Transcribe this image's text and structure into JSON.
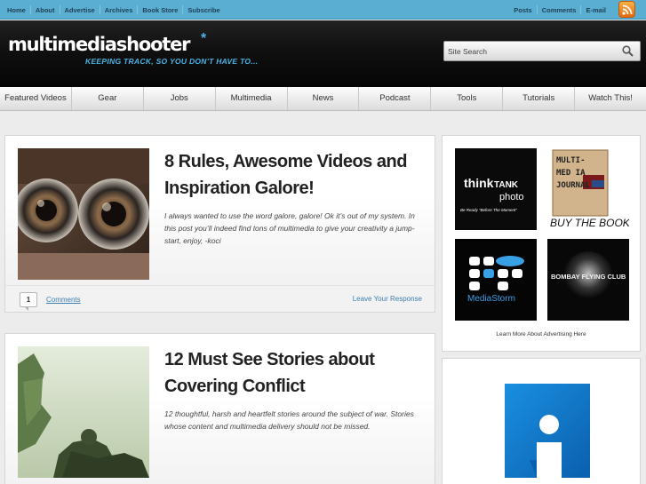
{
  "topbar": {
    "links": [
      "Home",
      "About",
      "Advertise",
      "Archives",
      "Book Store",
      "Subscribe"
    ],
    "right_links": [
      "Posts",
      "Comments",
      "E-mail"
    ],
    "rss_icon": "rss-icon"
  },
  "header": {
    "logo": "multimediashooter",
    "logo_star": "*",
    "tagline": "KEEPING TRACK, SO YOU DON'T HAVE TO...",
    "search_placeholder": "Site Search",
    "search_icon": "magnifier-icon"
  },
  "nav": {
    "items": [
      "Featured Videos",
      "Gear",
      "Jobs",
      "Multimedia",
      "News",
      "Podcast",
      "Tools",
      "Tutorials",
      "Watch This!"
    ]
  },
  "posts": [
    {
      "title": "8 Rules, Awesome Videos and Inspiration Galore!",
      "excerpt": "I always wanted to use the word galore, galore! Ok it’s out of my system. In this post you’ll indeed find tons of multimedia to give your creativity a jump-start, enjoy, -koci",
      "comment_count": "1",
      "comments_label": "Comments",
      "leave_label": "Leave Your Response"
    },
    {
      "title": "12 Must See Stories about Covering Conflict",
      "excerpt": "12 thoughtful, harsh and heartfelt stories around the subject of war. Stories whose content and multimedia delivery should not be missed."
    }
  ],
  "sidebar": {
    "ads": [
      {
        "line1": "think",
        "line2": "TANK",
        "line3": "photo",
        "sub": "Be Ready “Before The Moment”"
      },
      {
        "book_lines": [
          "MULTI-",
          "MED IA",
          "JOURNAL"
        ],
        "caption": "BUY THE BOOK"
      },
      {
        "name": "MediaStorm"
      },
      {
        "name": "BOMBAY FLYING CLUB"
      }
    ],
    "advertising_text": "Learn More About Advertising Here"
  },
  "colors": {
    "topbar": "#5aaed2",
    "accent": "#4ab4e6",
    "link": "#3b7fb0"
  }
}
